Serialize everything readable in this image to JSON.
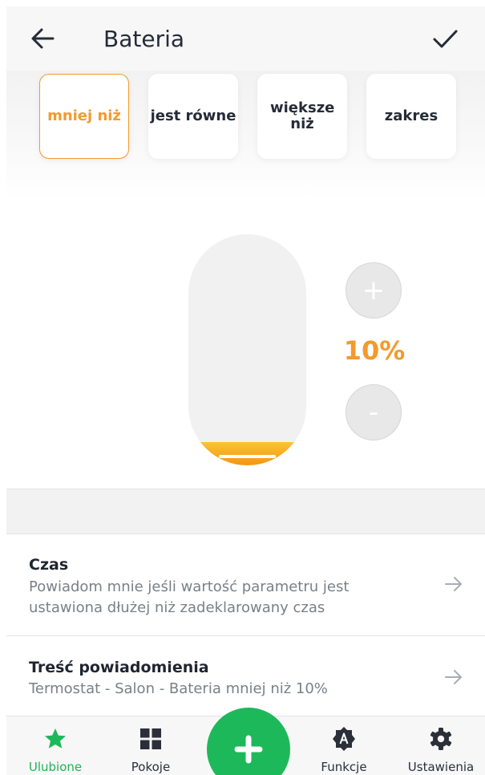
{
  "header": {
    "title": "Bateria",
    "back_icon": "arrow-left-icon",
    "confirm_icon": "check-icon"
  },
  "conditions": [
    {
      "label": "mniej niż",
      "active": true
    },
    {
      "label": "jest równe",
      "active": false
    },
    {
      "label": "większe niż",
      "active": false
    },
    {
      "label": "zakres",
      "active": false
    }
  ],
  "threshold": {
    "value_text": "10%",
    "value": 10,
    "increment_symbol": "+",
    "decrement_symbol": "-"
  },
  "options": [
    {
      "title": "Czas",
      "description": "Powiadom mnie jeśli wartość parametru jest ustawiona dłużej niż zadeklarowany czas"
    },
    {
      "title": "Treść powiadomienia",
      "description": "Termostat - Salon - Bateria  mniej niż 10%"
    }
  ],
  "nav": {
    "items": [
      {
        "label": "Ulubione",
        "icon": "star-icon",
        "active": true
      },
      {
        "label": "Pokoje",
        "icon": "grid-icon",
        "active": false
      },
      {
        "label": "Funkcje",
        "icon": "functions-badge-icon",
        "active": false
      },
      {
        "label": "Ustawienia",
        "icon": "gear-icon",
        "active": false
      }
    ],
    "fab_icon": "plus-icon"
  },
  "colors": {
    "accent": "#f39a2c",
    "green": "#1db85a",
    "text": "#252b38",
    "muted": "#7b7f87"
  }
}
